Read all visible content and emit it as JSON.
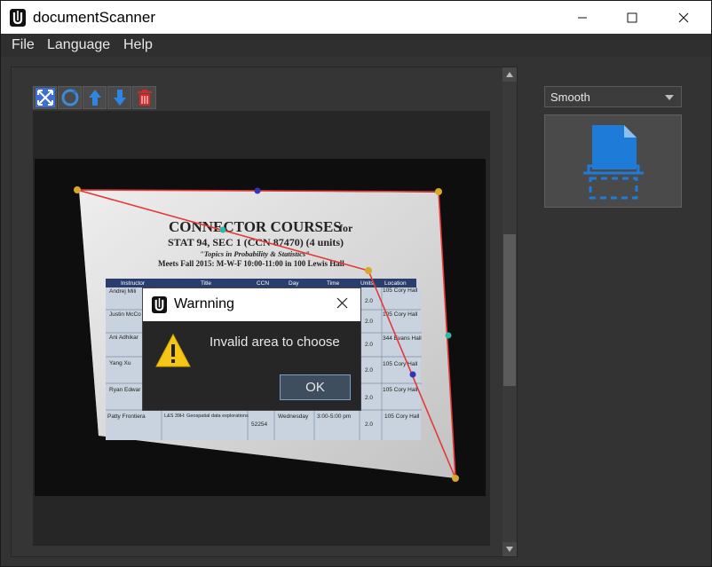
{
  "window": {
    "title": "documentScanner"
  },
  "menu": {
    "file": "File",
    "language": "Language",
    "help": "Help"
  },
  "toolbar": {
    "icons": [
      "fit-view-icon",
      "rotate-icon",
      "move-up-icon",
      "move-down-icon",
      "delete-icon"
    ]
  },
  "side_panel": {
    "mode_selected": "Smooth",
    "scan_icon": "document-scan-icon"
  },
  "photo": {
    "heading": "CONNECTOR COURSES",
    "heading_suffix": "for",
    "line2": "STAT 94, SEC 1 (CCN 87470) (4 units)",
    "line3": "\"Topics in Probability & Statistics\"",
    "line4": "Meets Fall 2015: M-W-F 10:00-11:00 in 100 Lewis Hall",
    "table_headers": [
      "Instructor",
      "Title",
      "CCN",
      "Day",
      "Time",
      "Units",
      "Location"
    ],
    "rows": [
      {
        "instructor": "Andrej Mili",
        "units": "2.0",
        "location": "105 Cory Hall"
      },
      {
        "instructor": "Justin McCo",
        "units": "2.0",
        "location": "105 Cory Hall"
      },
      {
        "instructor": "Ani Adhikar",
        "units": "2.0",
        "location": "344 Evans Hall"
      },
      {
        "instructor": "Yang Xu",
        "units": "2.0",
        "location": "105 Cory Hall"
      },
      {
        "instructor": "Ryan Edwar",
        "units": "2.0",
        "location": "105 Cory Hall"
      },
      {
        "instructor": "Patty Frontiera",
        "title": "L&S 39H: Geospatial data explorations",
        "ccn": "52254",
        "day": "Wednesday",
        "time": "3:00-5:00 pm",
        "units": "2.0",
        "location": "105 Cory Hall"
      }
    ]
  },
  "dialog": {
    "title": "Warnning",
    "message": "Invalid area to choose",
    "ok_label": "OK"
  },
  "colors": {
    "accent_blue": "#1e7bd8",
    "selection_red": "#e53935",
    "corner_yellow": "#e0b030",
    "warning_yellow": "#f5c518"
  }
}
